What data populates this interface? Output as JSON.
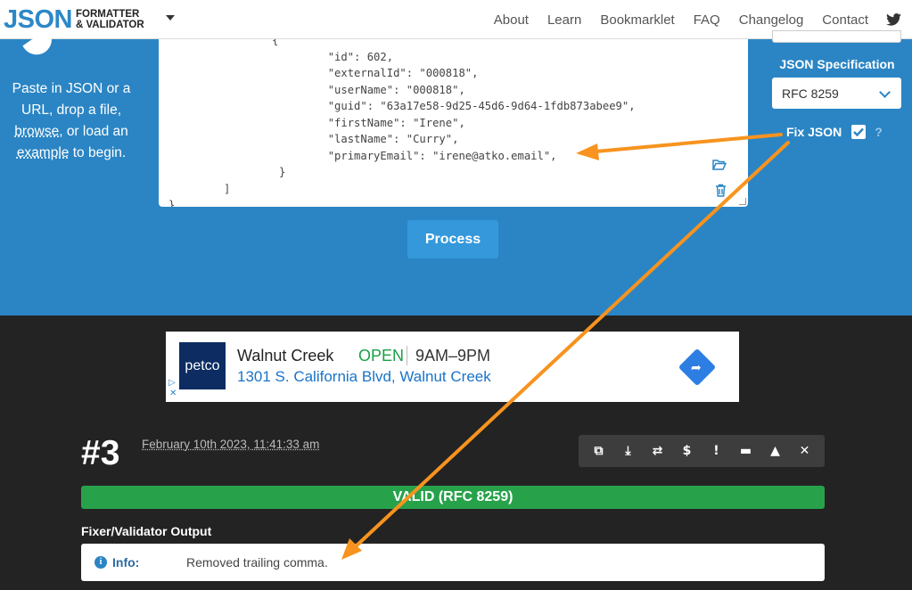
{
  "logo": {
    "main": "JSON",
    "line1": "FORMATTER",
    "line2": "& VALIDATOR"
  },
  "nav": {
    "items": [
      "About",
      "Learn",
      "Bookmarklet",
      "FAQ",
      "Changelog",
      "Contact"
    ],
    "twitter_icon": "twitter-icon"
  },
  "intro": {
    "part1": "Paste in JSON or a URL, drop a file,",
    "browse": "browse",
    "part2": ", or load an",
    "example": "example",
    "part3": "to begin."
  },
  "editor": {
    "lines": [
      "{",
      "        \"id\": 602,",
      "        \"externalId\": \"000818\",",
      "        \"userName\": \"000818\",",
      "        \"guid\": \"63a17e58-9d25-45d6-9d64-1fdb873abee9\",",
      "        \"firstName\": \"Irene\",",
      "        \"lastName\": \"Curry\",",
      "        \"primaryEmail\": \"irene@atko.email\",",
      "}",
      "]",
      "}"
    ]
  },
  "process_label": "Process",
  "spec": {
    "label": "JSON Specification",
    "selected": "RFC 8259"
  },
  "fix": {
    "label": "Fix JSON",
    "checked": true,
    "help": "?"
  },
  "ad": {
    "brand": "petco",
    "name": "Walnut Creek",
    "status": "OPEN",
    "hours": "9AM–9PM",
    "address": "1301 S. California Blvd, Walnut Creek"
  },
  "result": {
    "number": "#3",
    "date": "February 10th 2023, 11:41:33 am",
    "status": "VALID (RFC 8259)",
    "output_title": "Fixer/Validator Output",
    "info_label": "Info:",
    "info_message": "Removed trailing comma."
  },
  "colors": {
    "brand_blue": "#2b85c4",
    "valid_green": "#27a24b",
    "annotation_orange": "#f7931e"
  }
}
